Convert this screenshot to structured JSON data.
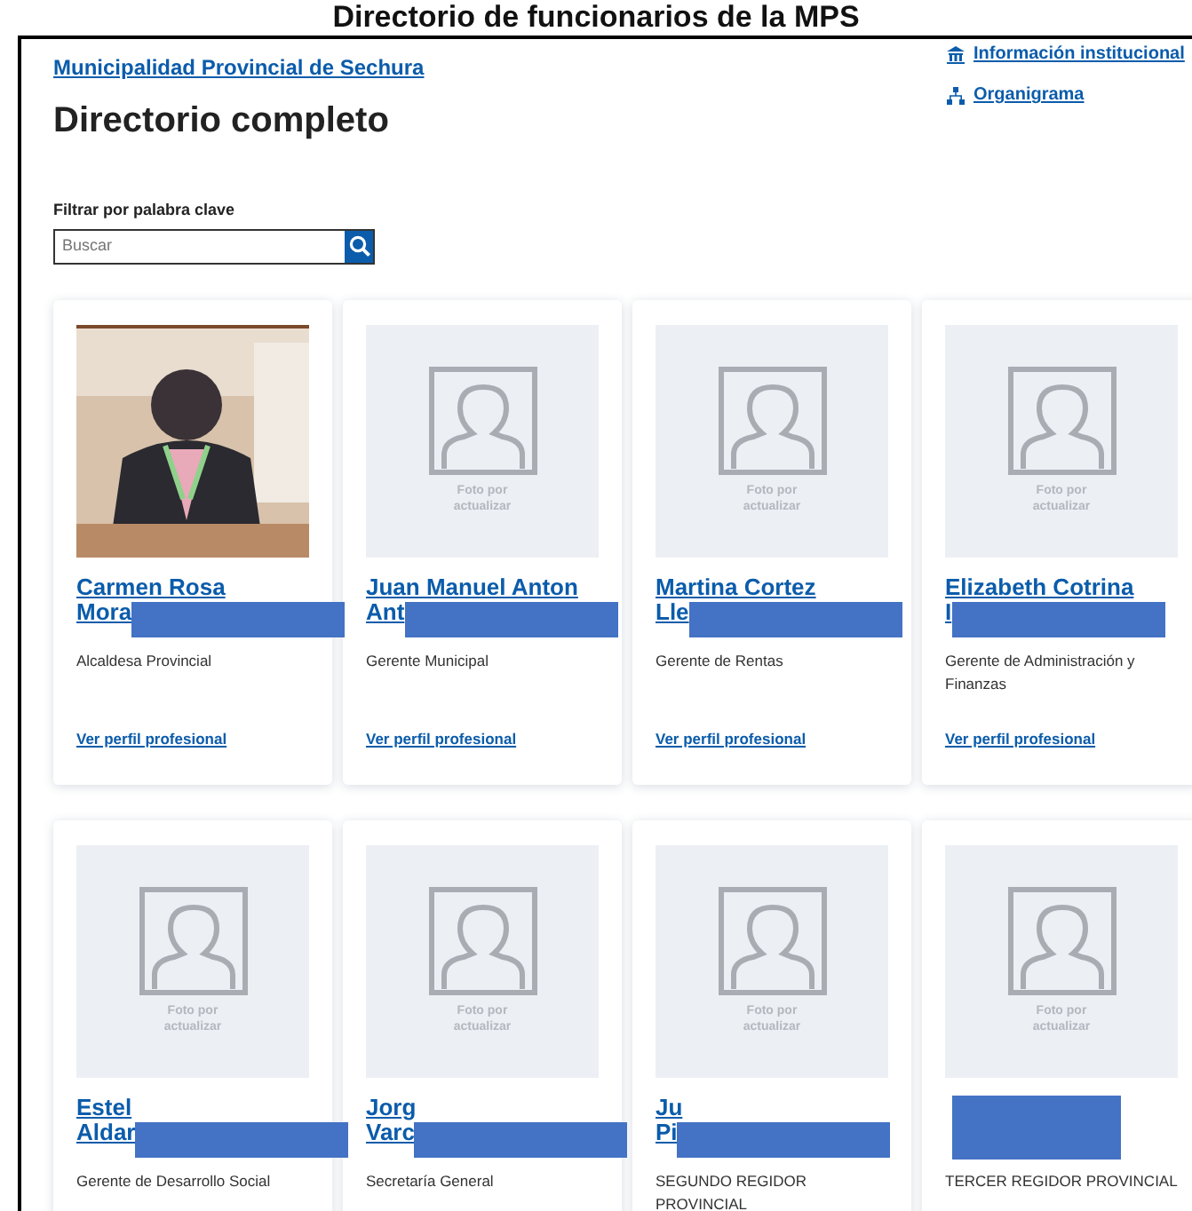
{
  "page_heading": "Directorio de funcionarios de la MPS",
  "breadcrumb_link": "Municipalidad Provincial de Sechura",
  "title": "Directorio completo",
  "side_links": [
    {
      "kind": "building",
      "label": "Información institucional"
    },
    {
      "kind": "org",
      "label": "Organigrama"
    }
  ],
  "filter": {
    "label": "Filtrar por palabra clave",
    "placeholder": "Buscar"
  },
  "people": [
    {
      "kind": "picture",
      "name_lines": [
        "Carmen Rosa",
        "Mora"
      ],
      "redacted": true,
      "role": "Alcaldesa Provincial",
      "link": "Ver perfil profesional"
    },
    {
      "photo_text": "Foto por actualizar",
      "name_lines": [
        "Juan Manuel Anton",
        "Ant"
      ],
      "redacted": true,
      "role": "Gerente Municipal",
      "link": "Ver perfil profesional"
    },
    {
      "photo_text": "Foto por actualizar",
      "name_lines": [
        "Martina Cortez",
        "Lle"
      ],
      "redacted": true,
      "role": "Gerente de Rentas",
      "link": "Ver perfil profesional"
    },
    {
      "photo_text": "Foto por actualizar",
      "name_lines": [
        "Elizabeth Cotrina",
        "I"
      ],
      "redacted": true,
      "role": "Gerente de Administración y Finanzas",
      "link": "Ver perfil profesional"
    },
    {
      "photo_text": "Foto por actualizar",
      "name_lines": [
        "Estel",
        "Aldar"
      ],
      "redacted": true,
      "role": "Gerente de Desarrollo Social"
    },
    {
      "photo_text": "Foto por actualizar",
      "name_lines": [
        "Jorg",
        "Varc"
      ],
      "redacted": true,
      "role": "Secretaría General"
    },
    {
      "photo_text": "Foto por actualizar",
      "name_lines": [
        "Ju",
        "Pi"
      ],
      "redacted": true,
      "role": "SEGUNDO REGIDOR PROVINCIAL"
    },
    {
      "photo_text": "Foto por actualizar",
      "redacted": true,
      "role": "TERCER REGIDOR PROVINCIAL"
    }
  ]
}
